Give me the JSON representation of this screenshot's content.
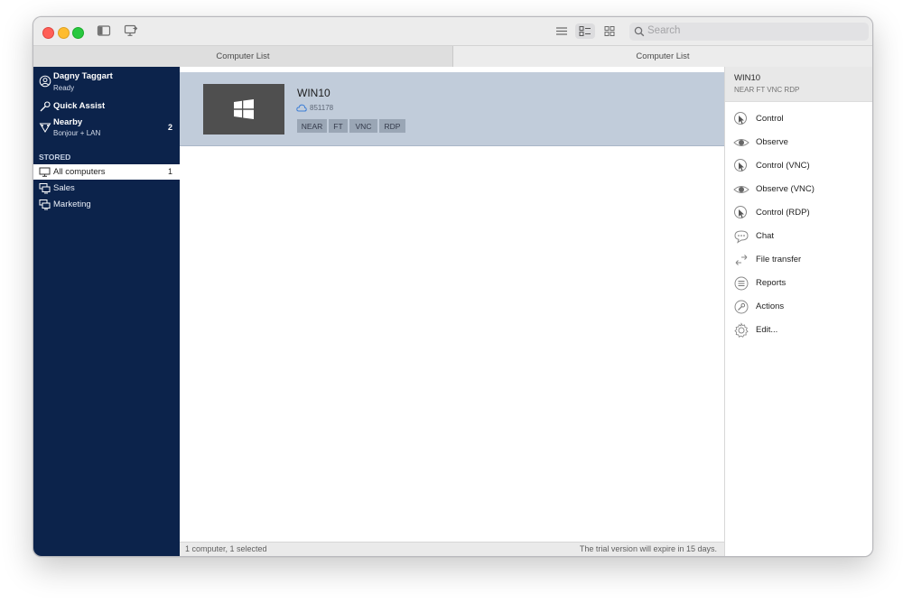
{
  "window": {
    "search": {
      "placeholder": "Search"
    }
  },
  "tabs": [
    {
      "label": "Computer List",
      "active": false
    },
    {
      "label": "Computer List",
      "active": true
    }
  ],
  "sidebar": {
    "user": {
      "name": "Dagny Taggart",
      "status": "Ready"
    },
    "quick_assist": {
      "label": "Quick Assist"
    },
    "nearby": {
      "label": "Nearby",
      "sub": "Bonjour + LAN",
      "count": "2"
    },
    "stored_header": "STORED",
    "items": [
      {
        "label": "All computers",
        "count": "1",
        "selected": true
      },
      {
        "label": "Sales",
        "count": "",
        "selected": false
      },
      {
        "label": "Marketing",
        "count": "",
        "selected": false
      }
    ]
  },
  "computer": {
    "name": "WIN10",
    "id": "851178",
    "tags": [
      "NEAR",
      "FT",
      "VNC",
      "RDP"
    ]
  },
  "statusbar": {
    "left": "1 computer, 1 selected",
    "right": "The trial version will expire in 15 days."
  },
  "panel": {
    "title": "WIN10",
    "subtitle": "NEAR FT VNC RDP",
    "actions": [
      {
        "label": "Control",
        "icon": "control-icon"
      },
      {
        "label": "Observe",
        "icon": "eye-icon"
      },
      {
        "label": "Control (VNC)",
        "icon": "control-icon"
      },
      {
        "label": "Observe (VNC)",
        "icon": "eye-icon"
      },
      {
        "label": "Control (RDP)",
        "icon": "control-icon"
      },
      {
        "label": "Chat",
        "icon": "chat-icon"
      },
      {
        "label": "File transfer",
        "icon": "transfer-icon"
      },
      {
        "label": "Reports",
        "icon": "reports-icon"
      },
      {
        "label": "Actions",
        "icon": "wrench-icon"
      },
      {
        "label": "Edit...",
        "icon": "gear-icon"
      }
    ]
  },
  "colors": {
    "sidebar_bg": "#0c234b",
    "selected_card_bg": "#c1ccda",
    "close": "#ff5f57",
    "minimize": "#febc2e",
    "maximize": "#28c840"
  }
}
